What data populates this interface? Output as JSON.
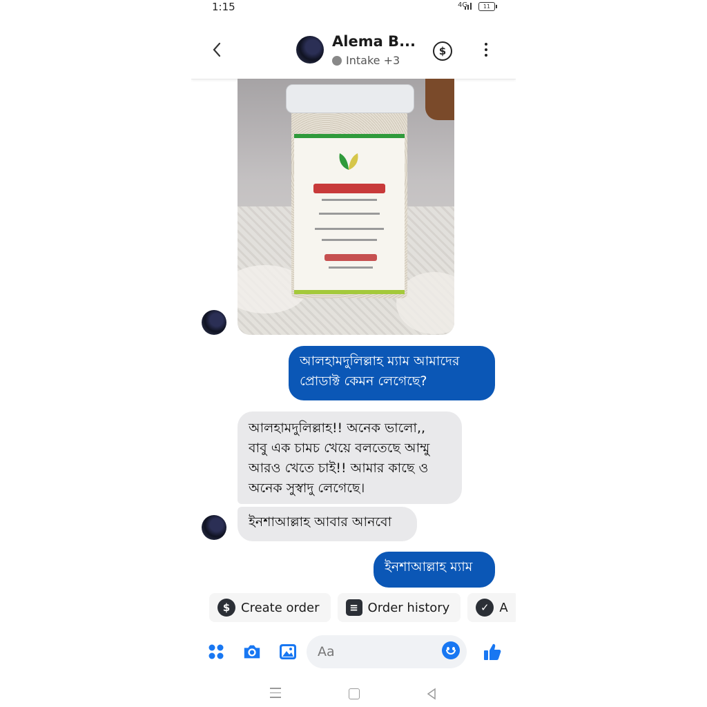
{
  "status_bar": {
    "time": "1:15",
    "network": "4G",
    "battery": "11"
  },
  "header": {
    "contact_name": "Alema B...",
    "subtitle": "Intake +3",
    "icons": [
      "back-arrow-icon",
      "dollar-icon",
      "more-vertical-icon"
    ]
  },
  "messages": [
    {
      "type": "image",
      "direction": "in",
      "description_icon": "product-photo"
    },
    {
      "type": "text",
      "direction": "out",
      "text": "আলহামদুলিল্লাহ ম্যাম আমাদের প্রোডাক্ট কেমন লেগেছে?"
    },
    {
      "type": "text",
      "direction": "in",
      "text": "আলহামদুলিল্লাহ!!  অনেক ভালো,,\nবাবু এক চামচ খেয়ে বলতেছে আম্মু\nআরও খেতে চাই!!  আমার কাছে ও\nঅনেক সুস্বাদু লেগেছে।"
    },
    {
      "type": "text",
      "direction": "in",
      "text": "ইনশাআল্লাহ আবার আনবো"
    },
    {
      "type": "text",
      "direction": "out",
      "text": "ইনশাআল্লাহ ম্যাম"
    }
  ],
  "quick_actions": [
    {
      "label": "Create order",
      "icon": "dollar-icon"
    },
    {
      "label": "Order history",
      "icon": "receipt-icon"
    },
    {
      "label": "A",
      "icon": "check-circle-icon"
    }
  ],
  "composer": {
    "placeholder": "Aa",
    "icons": [
      "apps-icon",
      "camera-icon",
      "gallery-icon",
      "emoji-icon",
      "thumbs-up-icon"
    ]
  },
  "colors": {
    "accent": "#0b57b6",
    "incoming_bubble": "#e9e9eb",
    "icon_blue": "#1877f2"
  }
}
